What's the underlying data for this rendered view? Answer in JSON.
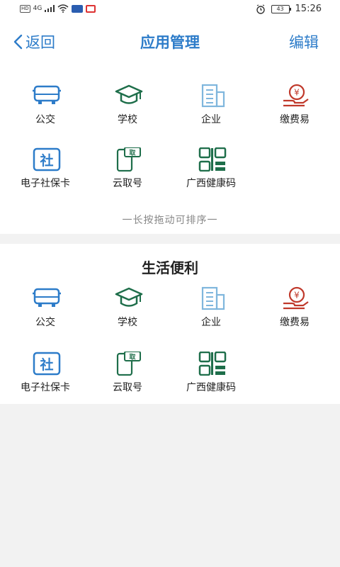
{
  "status": {
    "hd": "HD",
    "net": "4G",
    "battery": "43",
    "time": "15:26"
  },
  "nav": {
    "back_label": "返回",
    "title": "应用管理",
    "edit_label": "编辑"
  },
  "my_apps": {
    "items": [
      {
        "label": "公交",
        "icon": "bus-icon"
      },
      {
        "label": "学校",
        "icon": "graduation-cap-icon"
      },
      {
        "label": "企业",
        "icon": "building-icon"
      },
      {
        "label": "缴费易",
        "icon": "payment-hand-icon"
      },
      {
        "label": "电子社保卡",
        "icon": "social-security-card-icon"
      },
      {
        "label": "云取号",
        "icon": "phone-ticket-icon"
      },
      {
        "label": "广西健康码",
        "icon": "qr-code-icon"
      }
    ],
    "hint": "一长按拖动可排序一"
  },
  "life": {
    "title": "生活便利",
    "items": [
      {
        "label": "公交",
        "icon": "bus-icon"
      },
      {
        "label": "学校",
        "icon": "graduation-cap-icon"
      },
      {
        "label": "企业",
        "icon": "building-icon"
      },
      {
        "label": "缴费易",
        "icon": "payment-hand-icon"
      },
      {
        "label": "电子社保卡",
        "icon": "social-security-card-icon"
      },
      {
        "label": "云取号",
        "icon": "phone-ticket-icon"
      },
      {
        "label": "广西健康码",
        "icon": "qr-code-icon"
      }
    ]
  },
  "colors": {
    "accent": "#2d7cc9",
    "green": "#1e6e4a",
    "red": "#c0392b",
    "lightblue": "#7fb6dd"
  }
}
